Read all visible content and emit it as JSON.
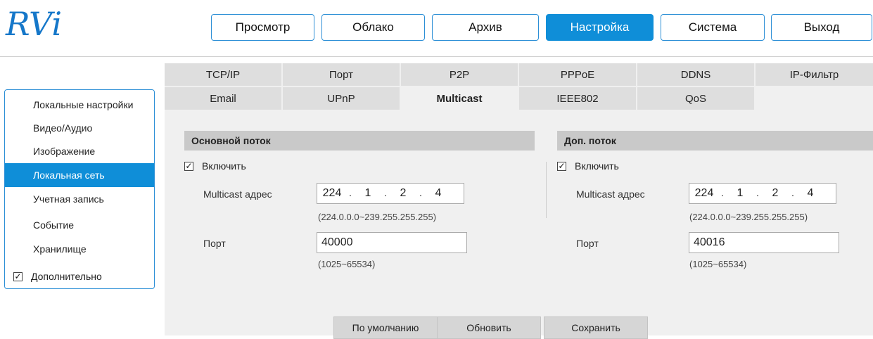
{
  "brand": {
    "logo_text": "RVi",
    "color": "#1577c9"
  },
  "topnav": {
    "items": [
      {
        "label": "Просмотр"
      },
      {
        "label": "Облако"
      },
      {
        "label": "Архив"
      },
      {
        "label": "Настройка",
        "active": true
      },
      {
        "label": "Система"
      },
      {
        "label": "Выход"
      }
    ]
  },
  "sidebar": {
    "items": [
      {
        "label": "Локальные настройки"
      },
      {
        "label": "Видео/Аудио"
      },
      {
        "label": "Изображение"
      },
      {
        "label": "Локальная сеть",
        "active": true
      },
      {
        "label": "Учетная запись"
      },
      {
        "label": "Событие"
      },
      {
        "label": "Хранилище"
      }
    ],
    "advanced": {
      "label": "Дополнительно",
      "checked": true
    }
  },
  "tabs": {
    "row1": [
      "TCP/IP",
      "Порт",
      "P2P",
      "PPPoE",
      "DDNS",
      "IP-Фильтр"
    ],
    "row2": [
      "Email",
      "UPnP",
      "Multicast",
      "IEEE802",
      "QoS"
    ],
    "active": "Multicast"
  },
  "main_stream": {
    "title": "Основной поток",
    "enable_label": "Включить",
    "enabled": true,
    "address_label": "Multicast адрес",
    "address": [
      "224",
      "1",
      "2",
      "4"
    ],
    "address_hint": "(224.0.0.0~239.255.255.255)",
    "port_label": "Порт",
    "port": "40000",
    "port_hint": "(1025~65534)"
  },
  "sub_stream": {
    "title": "Доп. поток",
    "enable_label": "Включить",
    "enabled": true,
    "address_label": "Multicast адрес",
    "address": [
      "224",
      "1",
      "2",
      "4"
    ],
    "address_hint": "(224.0.0.0~239.255.255.255)",
    "port_label": "Порт",
    "port": "40016",
    "port_hint": "(1025~65534)"
  },
  "buttons": {
    "default": "По умолчанию",
    "refresh": "Обновить",
    "save": "Сохранить"
  },
  "colors": {
    "accent": "#0f8ed8",
    "panel_bg": "#f0f0f0",
    "tab_bg": "#dedede",
    "section_bg": "#c9c9c9"
  }
}
